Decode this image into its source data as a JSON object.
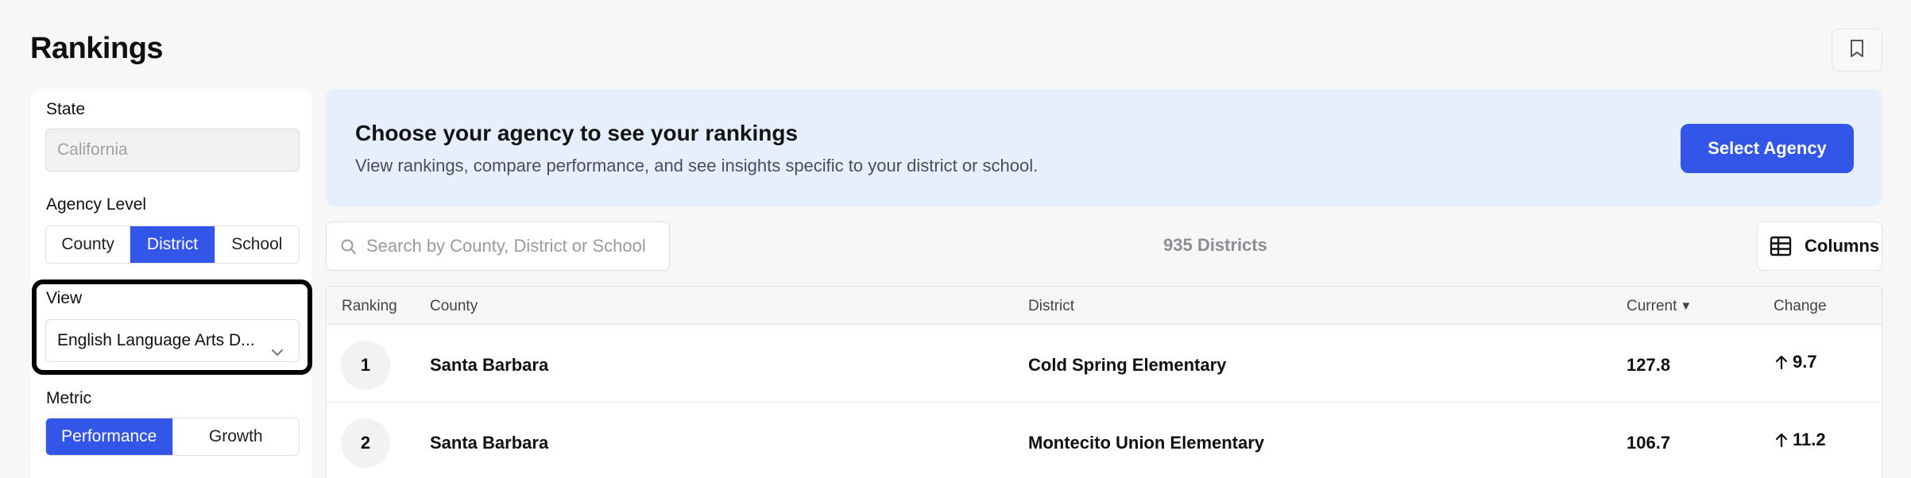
{
  "header": {
    "title": "Rankings"
  },
  "sidebar": {
    "state": {
      "label": "State",
      "value": "California"
    },
    "agency_level": {
      "label": "Agency Level",
      "options": [
        "County",
        "District",
        "School"
      ],
      "selected": "District"
    },
    "view": {
      "label": "View",
      "value": "English Language Arts D..."
    },
    "metric": {
      "label": "Metric",
      "options": [
        "Performance",
        "Growth"
      ],
      "selected": "Performance"
    }
  },
  "banner": {
    "title": "Choose your agency to see your rankings",
    "subtitle": "View rankings, compare performance, and see insights specific to your district or school.",
    "button_label": "Select Agency"
  },
  "toolbar": {
    "search_placeholder": "Search by County, District or School",
    "count": "935 Districts",
    "columns_label": "Columns"
  },
  "table": {
    "headers": {
      "ranking": "Ranking",
      "county": "County",
      "district": "District",
      "current": "Current",
      "change": "Change"
    },
    "rows": [
      {
        "rank": "1",
        "county": "Santa Barbara",
        "district": "Cold Spring Elementary",
        "current": "127.8",
        "change": "9.7"
      },
      {
        "rank": "2",
        "county": "Santa Barbara",
        "district": "Montecito Union Elementary",
        "current": "106.7",
        "change": "11.2"
      }
    ]
  },
  "colors": {
    "accent": "#3355e8",
    "banner_bg": "#e6effd",
    "page_bg": "#f7f7f7"
  }
}
